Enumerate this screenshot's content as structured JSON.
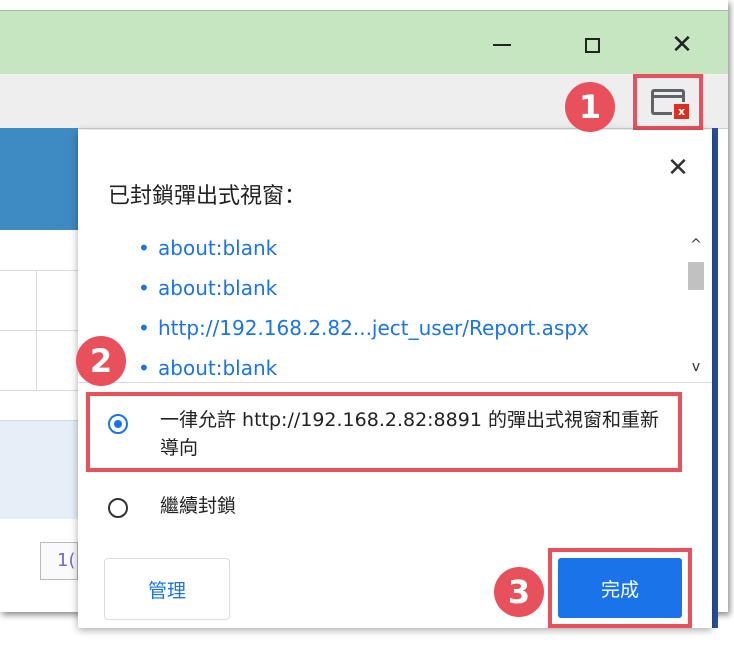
{
  "window": {
    "minimize_glyph": "",
    "maximize_glyph": "",
    "close_glyph": "✕"
  },
  "toolbar": {
    "popup_blocked_icon": "popup-blocked-icon"
  },
  "page": {
    "field_value": "1("
  },
  "dialog": {
    "title": "已封鎖彈出式視窗：",
    "close_glyph": "✕",
    "blocked_urls": [
      "about:blank",
      "about:blank",
      "http://192.168.2.82...ject_user/Report.aspx",
      "about:blank"
    ],
    "scroll_up_glyph": "^",
    "scroll_down_glyph": "v",
    "options": {
      "allow_label": "一律允許 http://192.168.2.82:8891 的彈出式視窗和重新導向",
      "block_label": "繼續封鎖",
      "selected": "allow"
    },
    "manage_label": "管理",
    "done_label": "完成"
  },
  "badges": {
    "step1": "1",
    "step2": "2",
    "step3": "3"
  },
  "colors": {
    "highlight": "#e8505b",
    "accent": "#1a73e8",
    "titlebar": "#c6e5c1"
  }
}
